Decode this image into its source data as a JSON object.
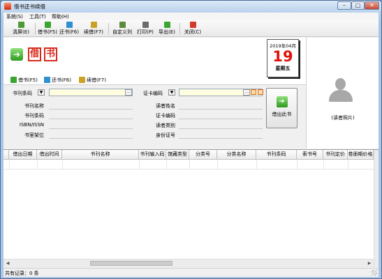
{
  "window": {
    "title": "借书还书续借",
    "controls": {
      "minimize": "–",
      "maximize": "□",
      "close": "✕"
    }
  },
  "menubar": {
    "items": [
      {
        "label": "系统(S)"
      },
      {
        "label": "工具(T)"
      },
      {
        "label": "帮助(H)"
      }
    ]
  },
  "toolbar": {
    "buttons": [
      {
        "label": "清屏(E)",
        "icon": "clear-icon",
        "color": "#4e9a38"
      },
      {
        "label": "借书(F5)",
        "icon": "borrow-icon",
        "color": "#3aa531"
      },
      {
        "label": "还书(F6)",
        "icon": "return-icon",
        "color": "#2f8fd0"
      },
      {
        "label": "续借(F7)",
        "icon": "renew-icon",
        "color": "#c9a227"
      },
      {
        "label": "自定义列",
        "icon": "columns-icon",
        "color": "#5b8a3c"
      },
      {
        "label": "打印(P)",
        "icon": "print-icon",
        "color": "#6b6b6b"
      },
      {
        "label": "导出(E)",
        "icon": "export-icon",
        "color": "#3aa531"
      },
      {
        "label": "关闭(C)",
        "icon": "close-icon",
        "color": "#d23a2a"
      }
    ]
  },
  "mode": {
    "seal_chars": [
      "借",
      "书"
    ],
    "items": [
      {
        "label": "借书(F5)",
        "icon": "borrow-icon"
      },
      {
        "label": "还书(F6)",
        "icon": "return-icon"
      },
      {
        "label": "续借(F7)",
        "icon": "renew-icon"
      }
    ]
  },
  "calendar": {
    "month": "2019年04月",
    "day": "19",
    "weekday": "星期五"
  },
  "book_form": {
    "selector_label": "书刊条码",
    "input_value": "",
    "ellipsis": "…",
    "fields": [
      {
        "label": "书刊名称",
        "value": ""
      },
      {
        "label": "书刊条码",
        "value": ""
      },
      {
        "label": "ISBN/ISSN",
        "value": ""
      },
      {
        "label": "书室架位",
        "value": ""
      }
    ]
  },
  "reader_form": {
    "selector_label": "证卡编码",
    "input_value": "",
    "ellipsis": "…",
    "fields": [
      {
        "label": "读者姓名",
        "value": ""
      },
      {
        "label": "证卡编码",
        "value": ""
      },
      {
        "label": "读者类别",
        "value": ""
      },
      {
        "label": "身份证号",
        "value": ""
      }
    ]
  },
  "borrow_button": {
    "label": "借出此书"
  },
  "reader_photo": {
    "label": "(读者照片)"
  },
  "grid": {
    "columns": [
      "借出日期",
      "借出时间",
      "书刊名称",
      "书刊输入码",
      "馆藏类型",
      "分类号",
      "分类名称",
      "书刊条码",
      "索书号",
      "书刊定价",
      "卷册期价格"
    ],
    "rows": []
  },
  "status": {
    "text": "共有记录：0 条"
  },
  "colors": {
    "accent_red": "#d9281a",
    "calendar_day": "#e0120a",
    "input_bg": "#fffde0"
  }
}
